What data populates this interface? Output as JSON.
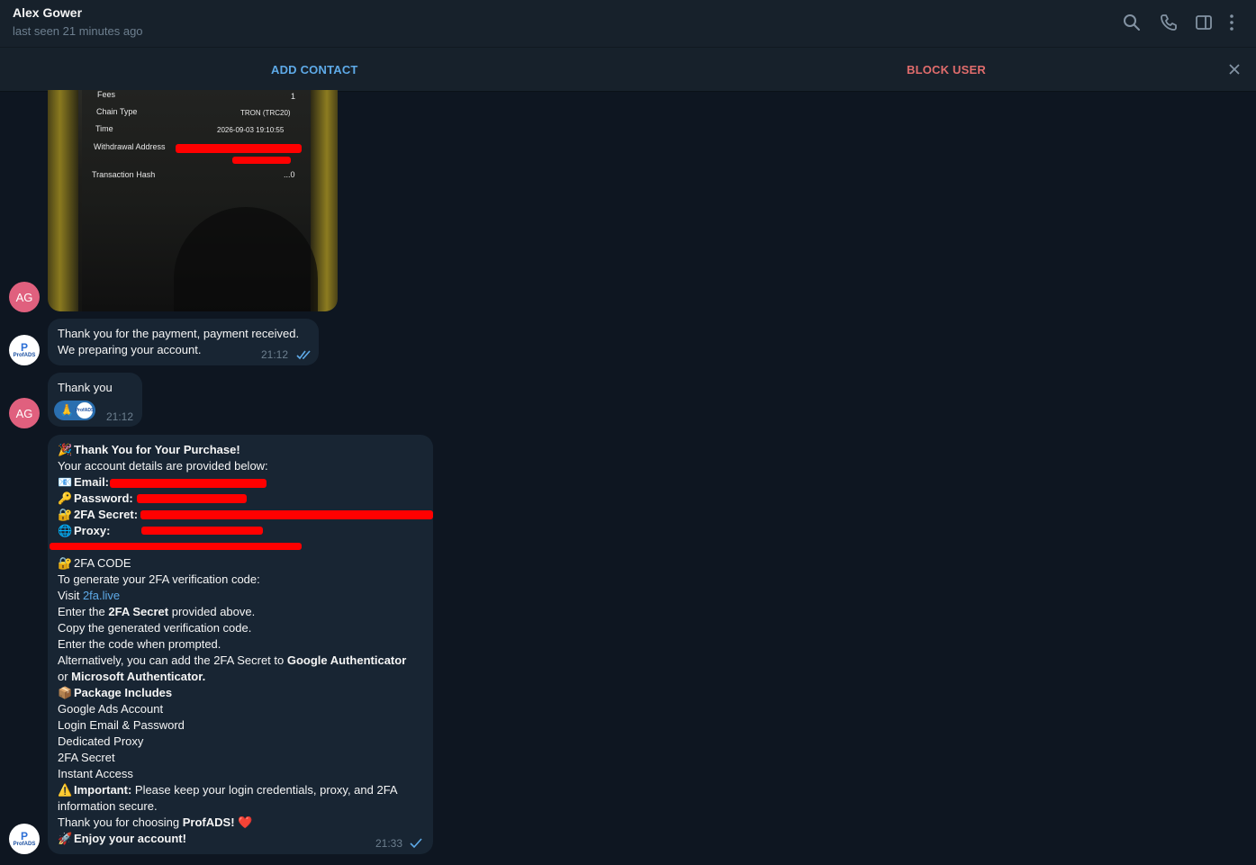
{
  "header": {
    "contact_name": "Alex Gower",
    "status": "last seen 21 minutes ago",
    "icons": [
      "search-icon",
      "phone-icon",
      "sidebar-toggle-icon",
      "more-vertical-icon"
    ]
  },
  "actionbar": {
    "add_contact": "ADD CONTACT",
    "block_user": "BLOCK USER"
  },
  "avatars": {
    "alex": "AG",
    "profads_mark": "P",
    "profads_name": "ProfADS"
  },
  "photo": {
    "rows": [
      {
        "label": "Fees",
        "value": "1"
      },
      {
        "label": "Chain Type",
        "value": "TRON (TRC20)"
      },
      {
        "label": "Time",
        "value": "2026-09-03 19:10:55"
      },
      {
        "label": "Withdrawal Address",
        "value": ""
      },
      {
        "label": "Transaction Hash",
        "value": "...0"
      }
    ]
  },
  "messages": {
    "m1": {
      "line1": "Thank you for the payment, payment received.",
      "line2": "We preparing your account.",
      "time": "21:12"
    },
    "m2": {
      "text": "Thank you",
      "time": "21:12",
      "reaction_emoji": "🙏"
    },
    "m3": {
      "title": "Thank You for Your Purchase!",
      "intro": "Your account details are provided below:",
      "email_label": "Email:",
      "password_label": "Password:",
      "secret_label": "2FA Secret:",
      "proxy_label": "Proxy:",
      "code_heading": "2FA CODE",
      "code_intro": "To generate your 2FA verification code:",
      "visit": "Visit ",
      "visit_link": "2fa.live",
      "step1_a": "Enter the ",
      "step1_b": "2FA Secret",
      "step1_c": " provided above.",
      "step2": "Copy the generated verification code.",
      "step3": "Enter the code when prompted.",
      "alt_a": "Alternatively, you can add the 2FA Secret to ",
      "alt_b": "Google Authenticator",
      "alt_c": "or ",
      "alt_d": "Microsoft Authenticator.",
      "package_heading": "Package Includes",
      "package_items": [
        "Google Ads Account",
        "Login Email & Password",
        "Dedicated Proxy",
        "2FA Secret",
        "Instant Access"
      ],
      "important_label": "Important:",
      "important_text": " Please keep your login credentials, proxy, and 2FA",
      "important_text2": "information secure.",
      "thanks_a": "Thank you for choosing ",
      "thanks_b": "ProfADS!",
      "enjoy": "Enjoy your account!",
      "time": "21:33"
    }
  },
  "emojis": {
    "party": "🎉",
    "email": "📧",
    "key": "🔑",
    "lock": "🔐",
    "globe": "🌐",
    "package": "📦",
    "warning": "⚠️",
    "heart": "❤️",
    "rocket": "🚀"
  },
  "colors": {
    "background": "#0e1621",
    "panel": "#17212b",
    "bubble": "#182533",
    "accent": "#5eaae8",
    "danger": "#e06c6c",
    "redaction": "#ff0000"
  }
}
